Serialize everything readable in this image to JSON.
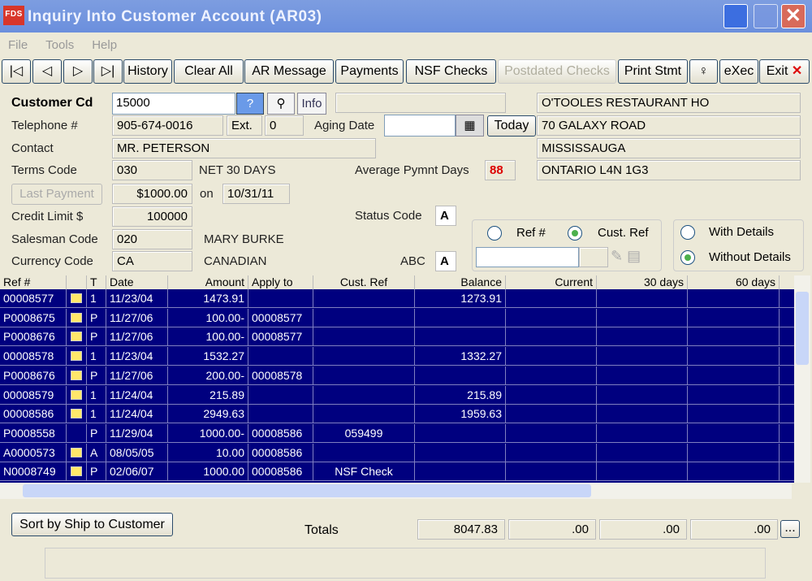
{
  "window": {
    "title": "Inquiry Into Customer Account  (AR03)",
    "logo": "FDS"
  },
  "menu": [
    "File",
    "Tools",
    "Help"
  ],
  "toolbar": {
    "first": "|◁",
    "prev": "◁",
    "next": "▷",
    "last": "▷|",
    "history": "History",
    "clear_all": "Clear All",
    "ar_message": "AR Message",
    "payments": "Payments",
    "nsf_checks": "NSF Checks",
    "postdated_checks": "Postdated Checks",
    "print_stmt": "Print Stmt",
    "exec": "eXec",
    "exit": "Exit"
  },
  "form": {
    "customer_cd_label": "Customer Cd",
    "customer_cd": "15000",
    "info_label": "Info",
    "telephone_label": "Telephone #",
    "telephone": "905-674-0016",
    "ext_label": "Ext.",
    "ext": "0",
    "aging_date_label": "Aging Date",
    "aging_date": "",
    "today_label": "Today",
    "contact_label": "Contact",
    "contact": "MR. PETERSON",
    "terms_label": "Terms Code",
    "terms_code": "030",
    "terms_desc": "NET 30 DAYS",
    "avg_days_label": "Average Pymnt Days",
    "avg_days": "88",
    "last_payment_label": "Last Payment",
    "last_payment": "$1000.00",
    "on_label": "on",
    "last_payment_date": "10/31/11",
    "credit_limit_label": "Credit Limit $",
    "credit_limit": "100000",
    "status_code_label": "Status Code",
    "status_code": "A",
    "salesman_label": "Salesman Code",
    "salesman_code": "020",
    "salesman_name": "MARY BURKE",
    "currency_label": "Currency Code",
    "currency_code": "CA",
    "currency_name": "CANADIAN",
    "abc_label": "ABC",
    "abc": "A",
    "address": [
      "O'TOOLES RESTAURANT HO",
      "70 GALAXY ROAD",
      "MISSISSAUGA",
      "ONTARIO L4N 1G3"
    ],
    "ref_radio": "Ref #",
    "cust_ref_radio": "Cust. Ref",
    "with_details": "With Details",
    "without_details": "Without Details"
  },
  "grid": {
    "columns": [
      "Ref #",
      "",
      "T",
      "Date",
      "Amount",
      "Apply to",
      "Cust. Ref",
      "Balance",
      "Current",
      "30 days",
      "60 days"
    ],
    "rows": [
      [
        "00008577",
        "folder",
        "1",
        "11/23/04",
        "1473.91",
        "",
        "",
        "1273.91"
      ],
      [
        "P0008675",
        "folder",
        "P",
        "11/27/06",
        "100.00-",
        "00008577",
        "",
        ""
      ],
      [
        "P0008676",
        "folder",
        "P",
        "11/27/06",
        "100.00-",
        "00008577",
        "",
        ""
      ],
      [
        "00008578",
        "folder",
        "1",
        "11/23/04",
        "1532.27",
        "",
        "",
        "1332.27"
      ],
      [
        "P0008676",
        "folder",
        "P",
        "11/27/06",
        "200.00-",
        "00008578",
        "",
        ""
      ],
      [
        "00008579",
        "folder",
        "1",
        "11/24/04",
        "215.89",
        "",
        "",
        "215.89"
      ],
      [
        "00008586",
        "folder",
        "1",
        "11/24/04",
        "2949.63",
        "",
        "",
        "1959.63"
      ],
      [
        "P0008558",
        "",
        "P",
        "11/29/04",
        "1000.00-",
        "00008586",
        "059499",
        ""
      ],
      [
        "A0000573",
        "folder",
        "A",
        "08/05/05",
        "10.00",
        "00008586",
        "",
        ""
      ],
      [
        "N0008749",
        "folder",
        "P",
        "02/06/07",
        "1000.00",
        "00008586",
        "NSF Check",
        ""
      ]
    ]
  },
  "footer": {
    "sort_button": "Sort by Ship to Customer",
    "totals_label": "Totals",
    "totals": [
      "8047.83",
      ".00",
      ".00",
      ".00"
    ],
    "more": "..."
  }
}
